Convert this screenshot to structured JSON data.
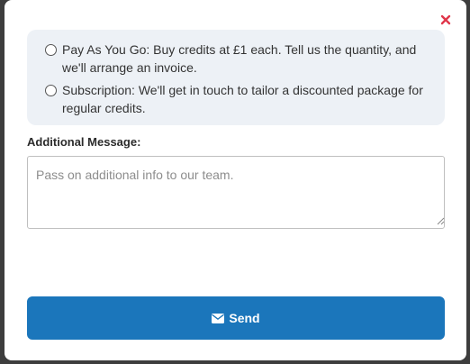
{
  "modal": {
    "close_icon": "close-icon",
    "close_color": "#e0364a",
    "options": [
      {
        "label": "Pay As You Go: Buy credits at £1 each. Tell us the quantity, and we'll arrange an invoice.",
        "selected": false
      },
      {
        "label": "Subscription: We'll get in touch to tailor a discounted package for regular credits.",
        "selected": false
      }
    ],
    "message": {
      "label": "Additional Message:",
      "value": "",
      "placeholder": "Pass on additional info to our team."
    },
    "send": {
      "icon": "envelope-icon",
      "label": "Send",
      "color": "#1b76bb"
    }
  }
}
